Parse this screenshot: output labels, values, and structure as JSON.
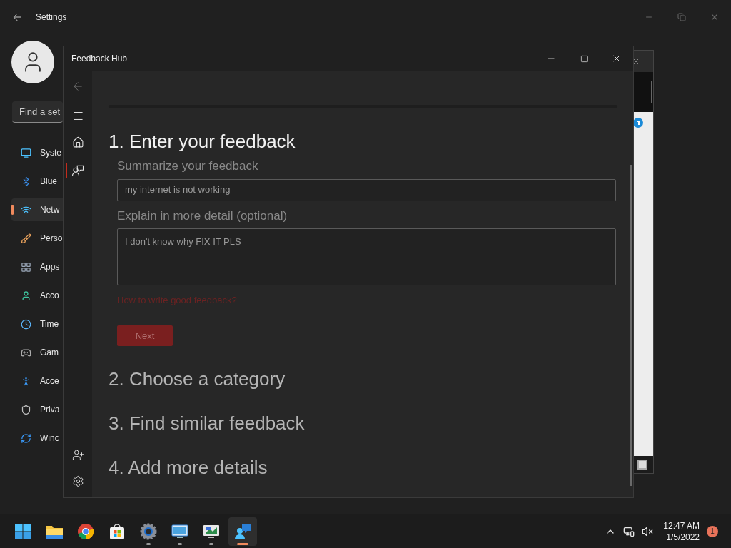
{
  "settings": {
    "title": "Settings",
    "search": {
      "placeholder": "Find a set"
    },
    "nav": [
      {
        "label": "Syste",
        "selected": false
      },
      {
        "label": "Blue",
        "selected": false
      },
      {
        "label": "Netw",
        "selected": true
      },
      {
        "label": "Perso",
        "selected": false
      },
      {
        "label": "Apps",
        "selected": false
      },
      {
        "label": "Acco",
        "selected": false
      },
      {
        "label": "Time",
        "selected": false
      },
      {
        "label": "Gam",
        "selected": false
      },
      {
        "label": "Acce",
        "selected": false
      },
      {
        "label": "Priva",
        "selected": false
      },
      {
        "label": "Winc",
        "selected": false
      }
    ]
  },
  "feedback_hub": {
    "title": "Feedback Hub",
    "rail": [
      {
        "kind": "home",
        "selected": false
      },
      {
        "kind": "feedback",
        "selected": true
      }
    ],
    "steps": [
      {
        "label": "1. Enter your feedback",
        "selected": true
      },
      {
        "label": "2. Choose a category",
        "selected": false
      },
      {
        "label": "3. Find similar feedback",
        "selected": false
      },
      {
        "label": "4. Add more details",
        "selected": false
      }
    ],
    "form": {
      "summary_label": "Summarize your feedback",
      "summary_value": "my internet is not working",
      "detail_label": "Explain in more detail (optional)",
      "detail_value": "I don't know why FIX IT PLS",
      "help_link": "How to write good feedback?",
      "next_button": {
        "label": "Next",
        "disabled": true
      }
    }
  },
  "taskbar": {
    "apps": [
      {
        "kind": "start",
        "running": false,
        "selected": false
      },
      {
        "kind": "folder",
        "running": false,
        "selected": false
      },
      {
        "kind": "browser",
        "running": false,
        "selected": false
      },
      {
        "kind": "store",
        "running": false,
        "selected": false
      },
      {
        "kind": "settings",
        "running": true,
        "selected": false
      },
      {
        "kind": "monitor",
        "running": true,
        "selected": false
      },
      {
        "kind": "presentation",
        "running": true,
        "selected": false
      },
      {
        "kind": "feedback",
        "running": true,
        "selected": true
      }
    ],
    "time": "12:47 AM",
    "date": "1/5/2022",
    "notifications": "1"
  }
}
